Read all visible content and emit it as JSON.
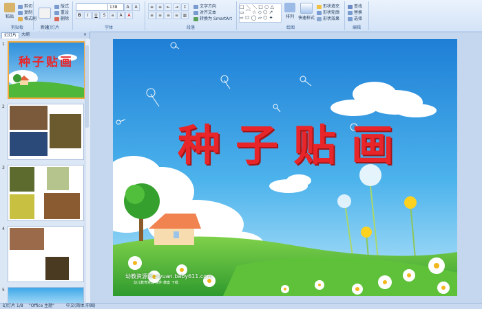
{
  "ribbon": {
    "clipboard": {
      "paste": "粘贴",
      "cut": "剪切",
      "copy": "复制",
      "format_painter": "格式刷",
      "label": "剪贴板"
    },
    "slides": {
      "new_slide": "新建\n幻灯片",
      "layout": "版式",
      "reset": "重设",
      "delete": "删除",
      "label": "幻灯片"
    },
    "font": {
      "size": "138",
      "label": "字体"
    },
    "paragraph": {
      "text_direction": "文字方向",
      "align_text": "对齐文本",
      "smartart": "转换为 SmartArt",
      "label": "段落"
    },
    "drawing": {
      "arrange": "排列",
      "quick_styles": "快速样式",
      "shape_fill": "形状填充",
      "shape_outline": "形状轮廓",
      "shape_effects": "形状效果",
      "label": "绘图"
    },
    "editing": {
      "find": "查找",
      "replace": "替换",
      "select": "选择",
      "label": "编辑"
    }
  },
  "pane": {
    "tab_slides": "幻灯片",
    "tab_outline": "大纲",
    "slide_numbers": [
      "1",
      "2",
      "3",
      "4",
      "5"
    ]
  },
  "slide": {
    "title": "种子贴画",
    "thumb_title": "种子贴画",
    "watermark_site": "幼教资源网 ziyuan.baby611.com",
    "watermark_sub": "幼儿教育资源 课件 教案 下载"
  },
  "status": {
    "slide_info": "幻灯片 1/8",
    "theme": "\"Office 主题\"",
    "language": "中文(简体,中国)"
  },
  "colors": {
    "title_red": "#e8262a",
    "sky": "#3ea7e8",
    "grass": "#4fb83a"
  }
}
